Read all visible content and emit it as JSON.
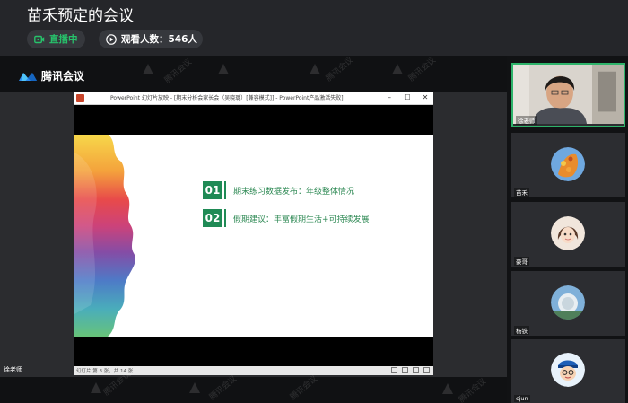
{
  "header": {
    "title": "苗禾预定的会议",
    "live_label": "直播中",
    "viewers_label": "观看人数：546人"
  },
  "brand": {
    "name": "腾讯会议"
  },
  "ppt": {
    "window_title": "PowerPoint 幻灯片放映 - [期末分析会家长会（吴晓璐）[兼容模式]] - PowerPoint产品激活失败]",
    "status_text": "幻灯片 第 3 张，共 14 张",
    "slide_items": [
      {
        "num": "01",
        "text": "期末练习数据发布：年级整体情况"
      },
      {
        "num": "02",
        "text": "假期建议：丰富假期生活+可持续发展"
      }
    ]
  },
  "presenter": {
    "name": "徐老师"
  },
  "participants": [
    {
      "name": "徐老师",
      "active": true
    },
    {
      "name": "苗禾",
      "active": false
    },
    {
      "name": "豪哥",
      "active": false
    },
    {
      "name": "杨铁",
      "active": false
    },
    {
      "name": "cjun",
      "active": false
    }
  ],
  "watermark_text": "腾讯会议",
  "colors": {
    "accent_green": "#27c26b",
    "slide_green": "#1f8a55"
  }
}
